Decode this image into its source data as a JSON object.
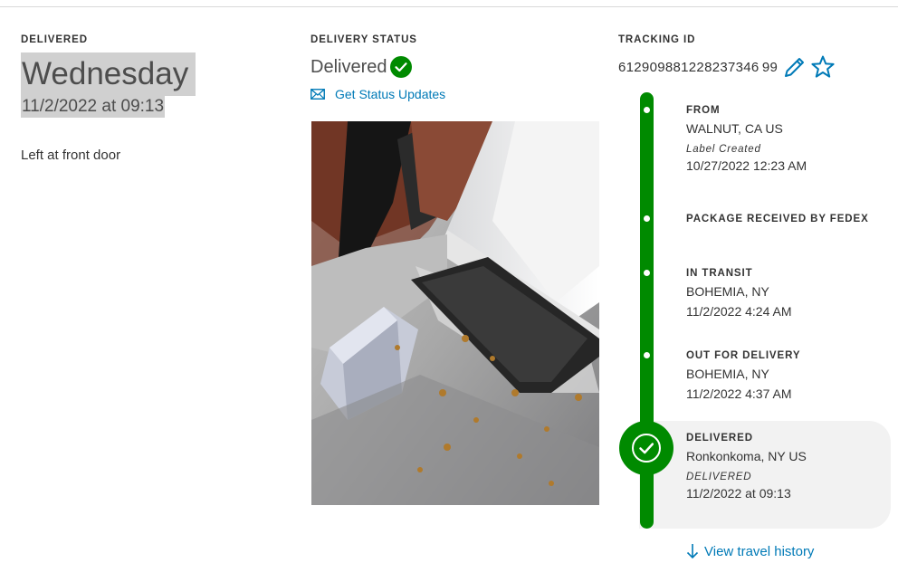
{
  "delivered": {
    "caption": "DELIVERED",
    "day": "Wednesday",
    "datetime": "11/2/2022 at 09:13",
    "note": "Left at front door"
  },
  "delivery_status": {
    "caption": "DELIVERY STATUS",
    "status": "Delivered",
    "status_icon": "check-circle-icon",
    "updates_link": "Get Status Updates",
    "updates_icon": "envelope-icon",
    "photo_icon": "delivery-photo"
  },
  "tracking": {
    "caption": "TRACKING ID",
    "id": "612909881228237346 99",
    "edit_icon": "pencil-icon",
    "favorite_icon": "star-icon"
  },
  "timeline": [
    {
      "title": "FROM",
      "location": "WALNUT, CA US",
      "subtitle": "Label Created",
      "date": "10/27/2022 12:23 AM"
    },
    {
      "title": "PACKAGE RECEIVED BY FEDEX"
    },
    {
      "title": "IN TRANSIT",
      "location": "BOHEMIA, NY",
      "date": "11/2/2022 4:24 AM"
    },
    {
      "title": "OUT FOR DELIVERY",
      "location": "BOHEMIA, NY",
      "date": "11/2/2022 4:37 AM"
    },
    {
      "title": "DELIVERED",
      "location": "Ronkonkoma, NY US",
      "subtitle": "DELIVERED",
      "date": "11/2/2022 at 09:13"
    }
  ],
  "history_link": "View travel history",
  "colors": {
    "accent_green": "#008a00",
    "link_blue": "#007ab7",
    "highlight_gray": "#d0d0d0"
  }
}
